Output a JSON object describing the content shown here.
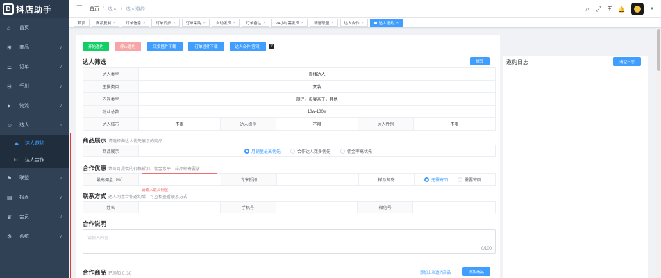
{
  "app": {
    "logo_mark": "D",
    "logo_text": "抖店助手"
  },
  "sidebar": {
    "items": [
      {
        "icon": "⌂",
        "label": "首页"
      },
      {
        "icon": "⊞",
        "label": "商品",
        "chevron": "∨"
      },
      {
        "icon": "☰",
        "label": "订单",
        "chevron": "∨"
      },
      {
        "icon": "⊟",
        "label": "千川",
        "chevron": "∨"
      },
      {
        "icon": "➤",
        "label": "物流",
        "chevron": "∨"
      },
      {
        "icon": "☺",
        "label": "达人",
        "chevron": "∧"
      }
    ],
    "subitems": [
      {
        "icon": "☁",
        "label": "达人邀约"
      },
      {
        "icon": "⊡",
        "label": "达人合作"
      }
    ],
    "items2": [
      {
        "icon": "⚑",
        "label": "联盟",
        "chevron": "∨"
      },
      {
        "icon": "▤",
        "label": "报表",
        "chevron": "∨"
      },
      {
        "icon": "♛",
        "label": "会员",
        "chevron": "∨"
      },
      {
        "icon": "⚙",
        "label": "系统",
        "chevron": "∨"
      }
    ]
  },
  "topbar": {
    "hamburger": "☰",
    "breadcrumb": [
      "首页",
      "达人",
      "达人邀约"
    ],
    "sep": "/",
    "icons": {
      "search": "⌕",
      "fullscreen": "⤢",
      "fontsize": "Ŧ",
      "bell": "🔔",
      "caret": "▼"
    }
  },
  "tags": [
    {
      "label": "首页",
      "closable": false
    },
    {
      "label": "商品复制",
      "closable": true
    },
    {
      "label": "订单信息",
      "closable": true
    },
    {
      "label": "订单同步",
      "closable": true
    },
    {
      "label": "订单采购",
      "closable": true
    },
    {
      "label": "自动发货",
      "closable": true
    },
    {
      "label": "订单备注",
      "closable": true
    },
    {
      "label": "24小时需发货",
      "closable": true
    },
    {
      "label": "精选联盟",
      "closable": true
    },
    {
      "label": "达人合作",
      "closable": true
    },
    {
      "label": "达人邀约",
      "closable": true,
      "active": true
    }
  ],
  "tag_close": "×",
  "toolbar": {
    "start": "开始邀约",
    "stop": "停止邀约",
    "plugin1": "采集插件下载",
    "plugin2": "订单插件下载",
    "official": "达人合作(官网)",
    "help": "?"
  },
  "filter": {
    "title": "达人筛选",
    "edit": "修改",
    "rows": [
      {
        "label": "达人类型",
        "value": "直播达人"
      },
      {
        "label": "主推类目",
        "value": "女装"
      },
      {
        "label": "内容类型",
        "value": "测评，母婴亲子，其他"
      },
      {
        "label": "粉丝总数",
        "value": "10w-100w"
      }
    ],
    "last_row": [
      {
        "label": "达人城市",
        "value": "不限"
      },
      {
        "label": "达人级别",
        "value": "不限"
      },
      {
        "label": "达人性别",
        "value": "不限"
      }
    ]
  },
  "log": {
    "title": "邀约日志",
    "clear": "清空日志"
  },
  "product_show": {
    "title": "商品展示",
    "sub": "请选择向达人优先展示的商品",
    "label": "商品展示",
    "options": [
      "月销量最高优先",
      "合作达人数多优先",
      "佣金率高优先"
    ],
    "selected": 0
  },
  "coop": {
    "title": "合作优惠",
    "sub": "填写可提供的价格折扣、佣金水平、样品邮寄要求",
    "commission_label": "最高佣金（%）",
    "commission_error": "请输入最高佣金",
    "discount_label": "专享折扣",
    "sample_label": "样品邮寄",
    "sample_options": [
      "无需寄回",
      "需要寄回"
    ],
    "sample_selected": 0
  },
  "contact": {
    "title": "联系方式",
    "sub": "达人同意合作邀约后，可互相查看联系方式",
    "fields": [
      "姓名",
      "手机号",
      "微信号"
    ]
  },
  "desc": {
    "title": "合作说明",
    "placeholder": "请输入内容",
    "counter": "0/100"
  },
  "products": {
    "title": "合作商品",
    "sub": "已添加 0 /30",
    "last_link": "添加上次邀约商品",
    "add": "添加商品"
  }
}
